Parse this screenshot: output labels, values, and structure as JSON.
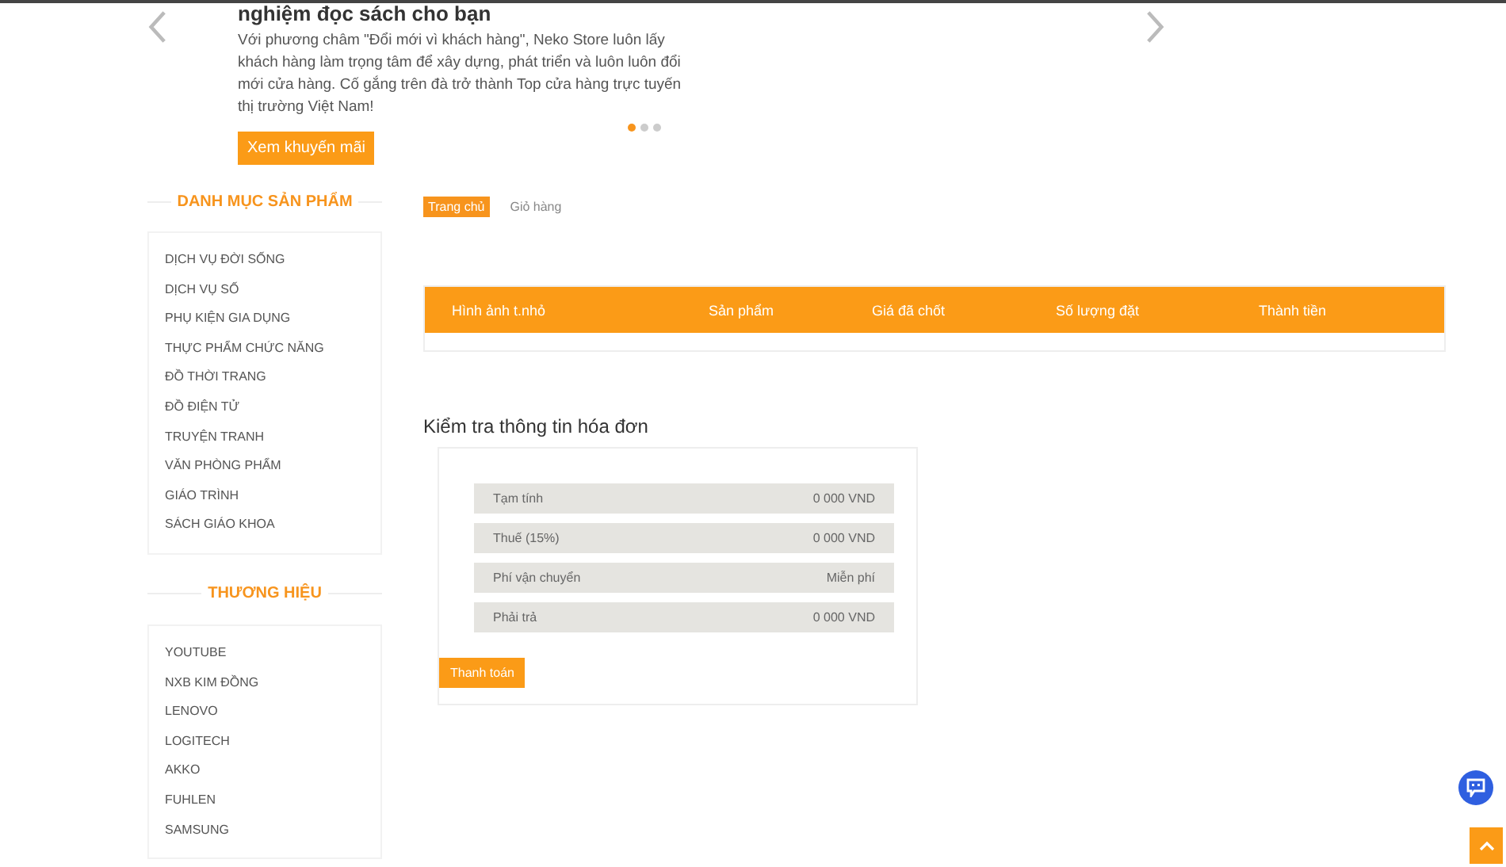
{
  "carousel": {
    "heading": "nghiệm đọc sách cho bạn",
    "text": "Với phương châm \"Đổi mới vì khách hàng\", Neko Store luôn lấy khách hàng làm trọng tâm để xây dựng, phát triển và luôn luôn đổi mới cửa hàng. Cố gắng trên đà trở thành Top cửa hàng trực tuyến thị trường Việt Nam!",
    "button": "Xem khuyến mãi",
    "dots": [
      {
        "selected": true
      },
      {
        "selected": false
      },
      {
        "selected": false
      }
    ]
  },
  "sidebar": {
    "sections": [
      {
        "title": "DANH MỤC SẢN PHẨM",
        "items": [
          "DỊCH VỤ ĐỜI SỐNG",
          "DỊCH VỤ SỐ",
          "PHỤ KIỆN GIA DỤNG",
          "THỰC PHẨM CHỨC NĂNG",
          "ĐỒ THỜI TRANG",
          "ĐỒ ĐIỆN TỬ",
          "TRUYỆN TRANH",
          "VĂN PHÒNG PHẨM",
          "GIÁO TRÌNH",
          "SÁCH GIÁO KHOA"
        ]
      },
      {
        "title": "THƯƠNG HIỆU",
        "items": [
          "YOUTUBE",
          "NXB KIM ĐỒNG",
          "LENOVO",
          "LOGITECH",
          "AKKO",
          "FUHLEN",
          "SAMSUNG"
        ]
      }
    ]
  },
  "breadcrumb": [
    {
      "label": "Trang chủ",
      "selected": true
    },
    {
      "label": "Giỏ hàng",
      "selected": false
    }
  ],
  "cart_table": {
    "columns": [
      "Hình ảnh t.nhỏ",
      "Sản phẩm",
      "Giá đã chốt",
      "Số lượng đặt",
      "Thành tiền"
    ]
  },
  "invoice": {
    "title": "Kiểm tra thông tin hóa đơn",
    "rows": [
      {
        "label": "Tạm tính",
        "value": "0 000 VND"
      },
      {
        "label": "Thuế (15%)",
        "value": "0 000 VND"
      },
      {
        "label": "Phí vận chuyển",
        "value": "Miễn phí"
      },
      {
        "label": "Phải trả",
        "value": "0 000 VND"
      }
    ],
    "button": "Thanh toán"
  }
}
